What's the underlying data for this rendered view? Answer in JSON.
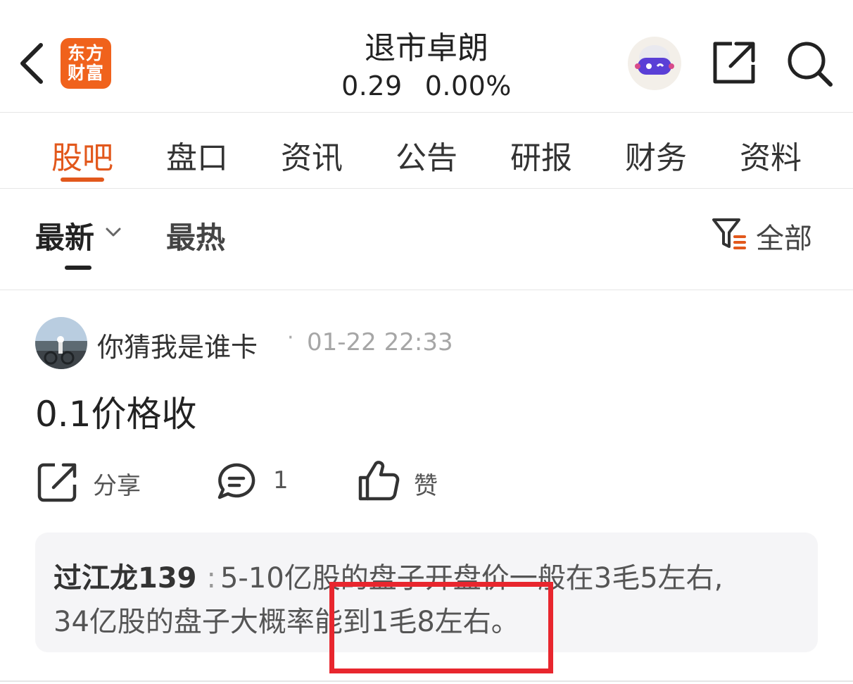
{
  "header": {
    "logo_line1": "东方",
    "logo_line2": "财富",
    "title": "退市卓朗",
    "price": "0.29",
    "change": "0.00%"
  },
  "tabs": [
    "股吧",
    "盘口",
    "资讯",
    "公告",
    "研报",
    "财务",
    "资料"
  ],
  "sort": {
    "newest": "最新",
    "hot": "最热",
    "filter_label": "全部"
  },
  "post": {
    "author": "你猜我是谁卡",
    "separator": "·",
    "time": "01-22 22:33",
    "content": "0.1价格收",
    "share_label": "分享",
    "comment_count": "1",
    "like_label": "赞"
  },
  "reply": {
    "author": "过江龙139",
    "colon": ":",
    "line1": "5-10亿股的盘子开盘价一般在3毛5左右,",
    "line2": "34亿股的盘子大概率能到1毛8左右。"
  },
  "colors": {
    "accent": "#e2581c",
    "brand": "#f0621c",
    "highlight": "#e8262e"
  }
}
